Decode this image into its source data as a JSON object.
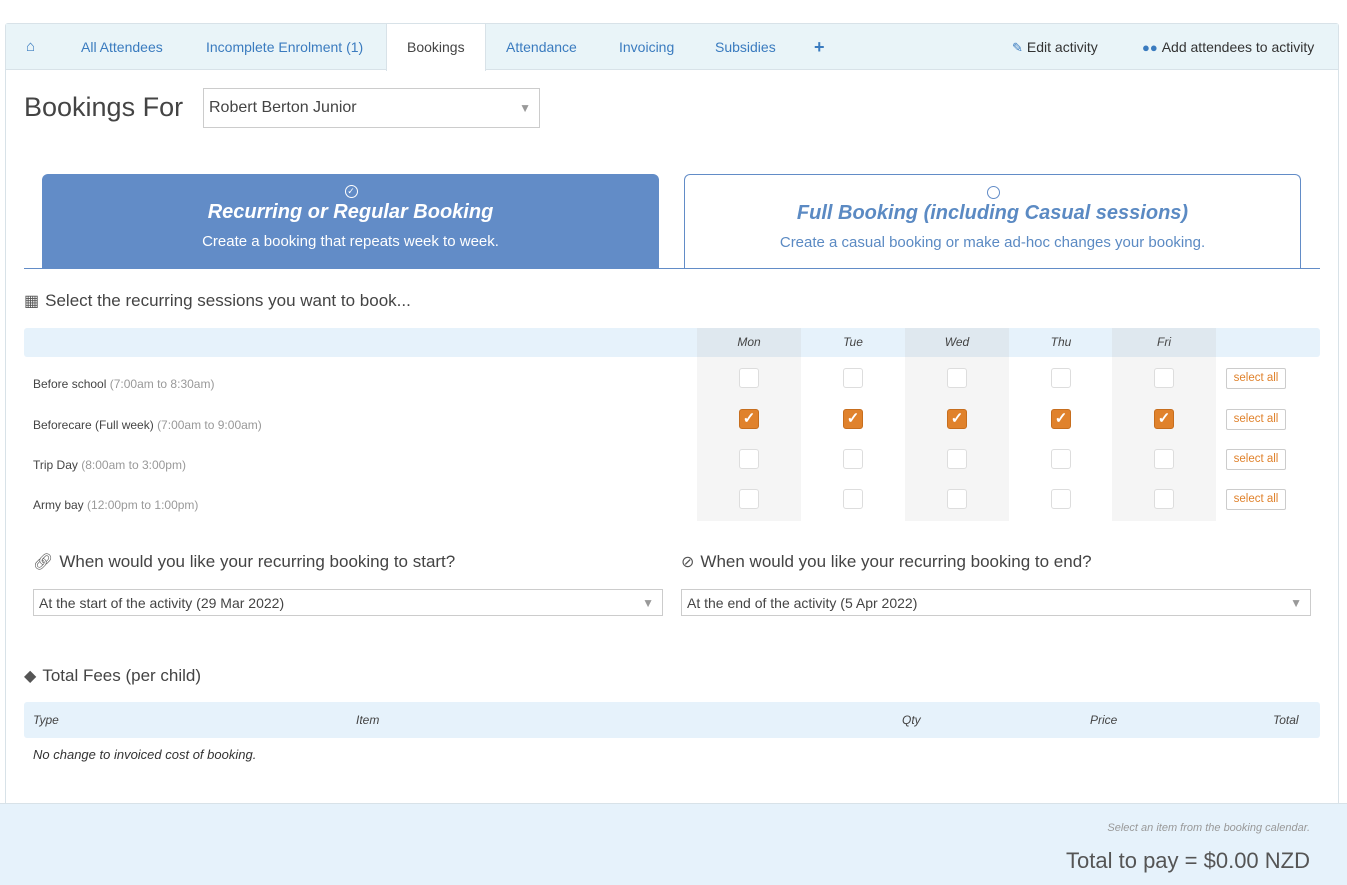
{
  "tabs": {
    "home_icon": "home-icon",
    "all_attendees": "All Attendees",
    "incomplete_enrolment": "Incomplete Enrolment (1)",
    "bookings": "Bookings",
    "attendance": "Attendance",
    "invoicing": "Invoicing",
    "subsidies": "Subsidies",
    "add": "+",
    "edit_activity": "Edit activity",
    "add_attendees": "Add attendees to activity"
  },
  "page": {
    "heading": "Bookings For",
    "person_selected": "Robert Berton Junior"
  },
  "booking_options": {
    "recurring_title": "Recurring or Regular Booking",
    "recurring_sub": "Create a booking that repeats week to week.",
    "full_title": "Full Booking (including Casual sessions)",
    "full_sub": "Create a casual booking or make ad-hoc changes your booking."
  },
  "sessions": {
    "title": "Select the recurring sessions you want to book...",
    "days": [
      "Mon",
      "Tue",
      "Wed",
      "Thu",
      "Fri"
    ],
    "select_all_label": "select all",
    "rows": [
      {
        "name": "Before school",
        "time": "(7:00am to 8:30am)",
        "checked": [
          false,
          false,
          false,
          false,
          false
        ]
      },
      {
        "name": "Beforecare (Full week)",
        "time": "(7:00am to 9:00am)",
        "checked": [
          true,
          true,
          true,
          true,
          true
        ]
      },
      {
        "name": "Trip Day",
        "time": "(8:00am to 3:00pm)",
        "checked": [
          false,
          false,
          false,
          false,
          false
        ]
      },
      {
        "name": "Army bay",
        "time": "(12:00pm to 1:00pm)",
        "checked": [
          false,
          false,
          false,
          false,
          false
        ]
      }
    ]
  },
  "start": {
    "question": "When would you like your recurring booking to start?",
    "value": "At the start of the activity (29 Mar 2022)"
  },
  "end": {
    "question": "When would you like your recurring booking to end?",
    "value": "At the end of the activity (5 Apr 2022)"
  },
  "fees": {
    "title": "Total Fees (per child)",
    "columns": {
      "type": "Type",
      "item": "Item",
      "qty": "Qty",
      "price": "Price",
      "total": "Total"
    },
    "empty_message": "No change to invoiced cost of booking."
  },
  "footer": {
    "hint": "Select an item from the booking calendar.",
    "total": "Total to pay = $0.00 NZD"
  },
  "colors": {
    "accent_blue": "#628cc7",
    "checkbox_orange": "#e0822c",
    "light_blue_bg": "#e6f2fb"
  }
}
